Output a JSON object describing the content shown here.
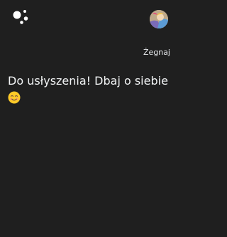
{
  "conversation": {
    "user_query": "Żegnaj",
    "assistant_response": "Do usłyszenia! Dbaj o siebie"
  },
  "icons": {
    "assistant_logo": "google-assistant-icon",
    "avatar": "user-avatar",
    "response_emoji": "smiling-face-emoji-icon"
  },
  "colors": {
    "background": "#1f1f1f",
    "text_primary": "#f1f3f4",
    "emoji_face": "#ffca28"
  }
}
